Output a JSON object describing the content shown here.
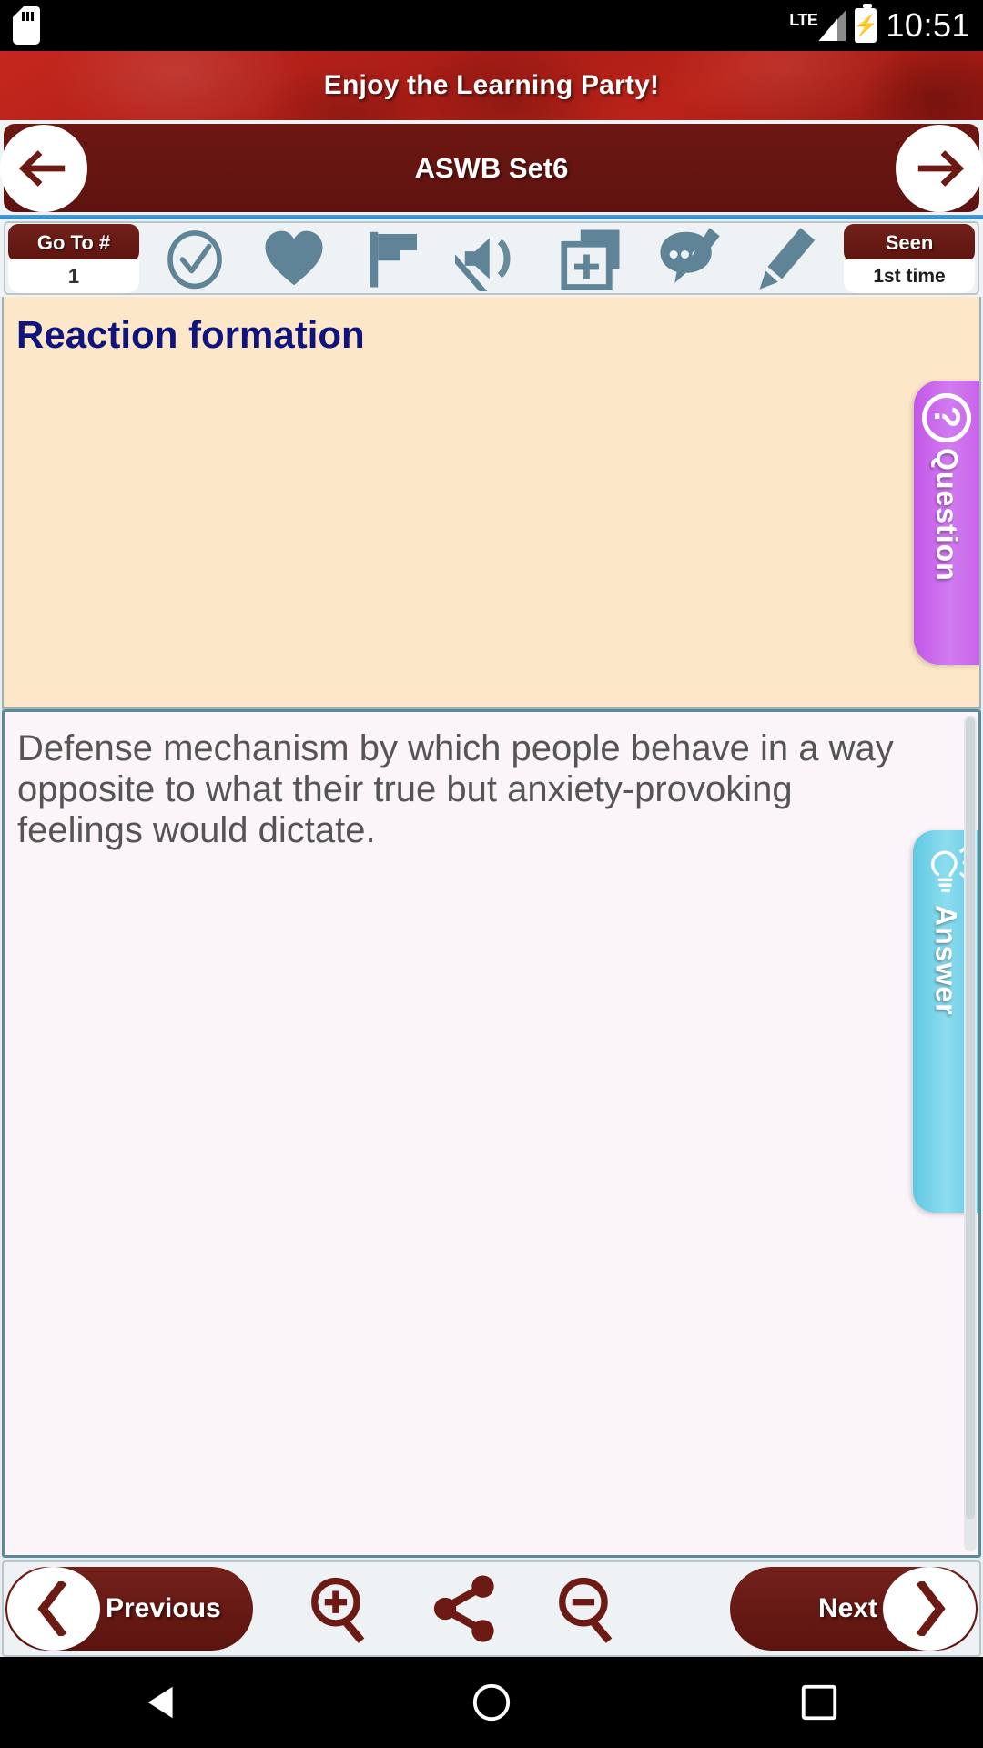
{
  "status_bar": {
    "sd_card_icon": "sd-card-icon",
    "network_label": "LTE",
    "signal_icon": "signal-bars-icon",
    "battery_icon": "battery-charging-icon",
    "time": "10:51"
  },
  "banner": {
    "text": "Enjoy the Learning Party!",
    "background_color": "#b52118"
  },
  "navbar": {
    "title": "ASWB Set6",
    "back_icon": "arrow-left-icon",
    "forward_icon": "arrow-right-icon",
    "background_color": "#661510"
  },
  "toolbar": {
    "goto_label": "Go To #",
    "goto_value": "1",
    "seen_label": "Seen",
    "seen_value": "1st time",
    "icons": [
      {
        "name": "check-circle-icon",
        "label": "Known"
      },
      {
        "name": "heart-icon",
        "label": "Favorite"
      },
      {
        "name": "flag-icon",
        "label": "Flag"
      },
      {
        "name": "mute-icon",
        "label": "Mute"
      },
      {
        "name": "add-to-box-icon",
        "label": "Add to set"
      },
      {
        "name": "comment-edit-icon",
        "label": "Note"
      },
      {
        "name": "pencil-icon",
        "label": "Edit"
      }
    ],
    "icon_color": "#5f8497"
  },
  "question_card": {
    "title": "Reaction formation",
    "tab_label": "Question",
    "tab_icon": "question-mark-icon",
    "tab_color": "#cc66ea",
    "background_color": "#fce8c8",
    "title_color": "#12147d"
  },
  "answer_card": {
    "text": "Defense mechanism by which people behave in a way opposite to what their true but anxiety-provoking feelings would dictate.",
    "tab_label": "Answer",
    "tab_icon": "lightbulb-icon",
    "tab_color": "#6fcee6",
    "background_color": "#fbf5fa",
    "text_color": "#555555"
  },
  "bottom_bar": {
    "previous_label": "Previous",
    "next_label": "Next",
    "prev_arrow_icon": "chevron-left-icon",
    "next_arrow_icon": "chevron-right-icon",
    "zoom_in_icon": "zoom-in-icon",
    "share_icon": "share-icon",
    "zoom_out_icon": "zoom-out-icon",
    "button_color": "#6e1a14"
  },
  "android_nav": {
    "back_icon": "triangle-back-icon",
    "home_icon": "circle-home-icon",
    "recents_icon": "square-recents-icon"
  }
}
